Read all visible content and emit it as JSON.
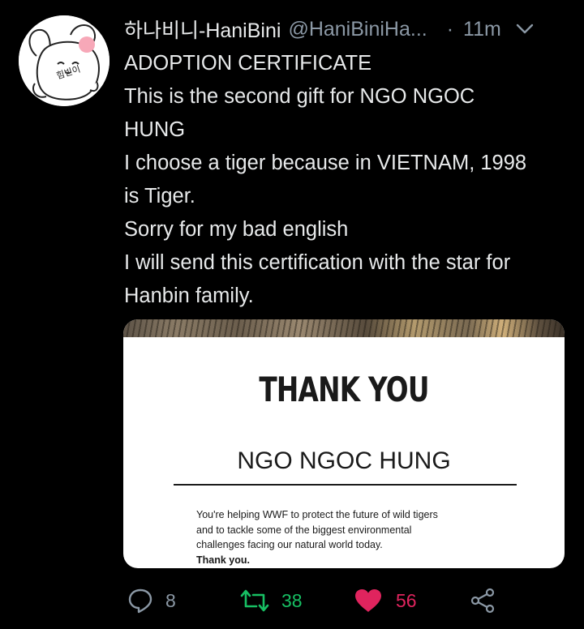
{
  "tweet": {
    "display_name": "하나비니-HaniBini",
    "handle": "@HaniBiniHa...",
    "separator": "·",
    "time": "11m",
    "body_lines": [
      "ADOPTION CERTIFICATE",
      "This is the second gift for NGO NGOC",
      "HUNG",
      "I choose a tiger because in VIETNAM, 1998",
      "is Tiger.",
      "Sorry for my bad english",
      "I will send this certification with the star for",
      "Hanbin family."
    ],
    "avatar_text": "힘빈이"
  },
  "certificate": {
    "title": "THANK YOU",
    "name": "NGO NGOC HUNG",
    "message_lines": [
      "You're helping WWF to protect the future of wild tigers",
      "and to tackle some of the biggest environmental",
      "challenges facing our natural world today."
    ],
    "thanks": "Thank you."
  },
  "actions": {
    "reply_count": "8",
    "retweet_count": "38",
    "like_count": "56"
  },
  "colors": {
    "background": "#000000",
    "text": "#e7e9ea",
    "muted": "#8b98a5",
    "retweet_green": "#17bf63",
    "like_pink": "#e0245e"
  },
  "icons": [
    "chevron-down-icon",
    "reply-icon",
    "retweet-icon",
    "heart-icon",
    "share-icon"
  ]
}
